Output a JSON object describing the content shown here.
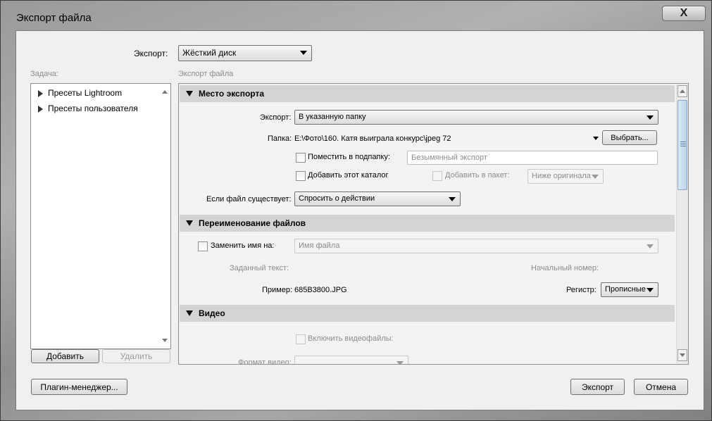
{
  "window": {
    "title": "Экспорт файла",
    "close_label": "X"
  },
  "export_to": {
    "label": "Экспорт:",
    "value": "Жёсткий диск"
  },
  "task_panel": {
    "header": "Задача:",
    "items": [
      {
        "label": "Пресеты Lightroom"
      },
      {
        "label": "Пресеты пользователя"
      }
    ],
    "add_button": "Добавить",
    "remove_button": "Удалить"
  },
  "settings_panel": {
    "header": "Экспорт файла"
  },
  "section_location": {
    "title": "Место экспорта",
    "export_label": "Экспорт:",
    "export_value": "В указанную папку",
    "folder_label": "Папка:",
    "folder_value": "E:\\Фото\\160. Катя выиграла конкурс\\jpeg 72",
    "choose_button": "Выбрать...",
    "subfolder_label": "Поместить в подпапку:",
    "subfolder_value": "Безымянный экспорт",
    "add_catalog_label": "Добавить этот каталог",
    "add_to_stack_label": "Добавить в пакет:",
    "stack_value": "Ниже оригинала",
    "if_exists_label": "Если файл существует:",
    "if_exists_value": "Спросить о действии"
  },
  "section_rename": {
    "title": "Переименование файлов",
    "rename_label": "Заменить имя на:",
    "rename_value": "Имя файла",
    "custom_text_label": "Заданный текст:",
    "start_number_label": "Начальный номер:",
    "example_label": "Пример:",
    "example_value": "685B3800.JPG",
    "case_label": "Регистр:",
    "case_value": "Прописные"
  },
  "section_video": {
    "title": "Видео",
    "include_video_label": "Включить видеофайлы:",
    "video_format_label": "Формат видео:"
  },
  "footer": {
    "plugin_manager_button": "Плагин-менеджер...",
    "export_button": "Экспорт",
    "cancel_button": "Отмена"
  }
}
